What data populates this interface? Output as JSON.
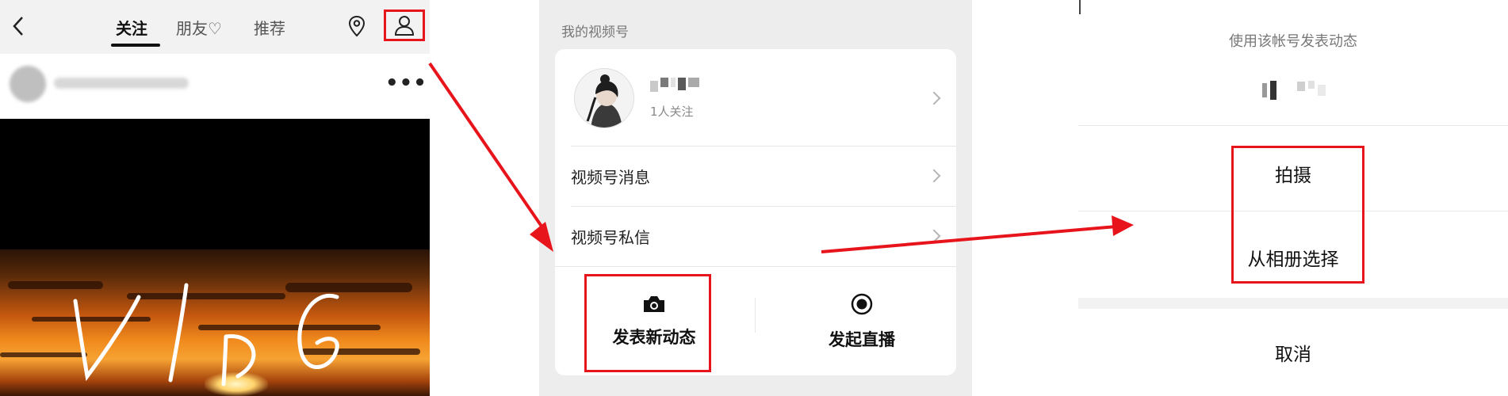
{
  "feed_screen": {
    "tabs": [
      {
        "label": "关注",
        "active": true
      },
      {
        "label": "朋友♡",
        "active": false
      },
      {
        "label": "推荐",
        "active": false
      }
    ],
    "icons": [
      "back-icon",
      "location-icon",
      "person-icon",
      "more-icon"
    ],
    "more_label": "•••",
    "video_overlay_text": "VLOG"
  },
  "channel_screen": {
    "section_title": "我的视频号",
    "profile": {
      "follow_count": "1人关注"
    },
    "menu_items": [
      {
        "label": "视频号消息"
      },
      {
        "label": "视频号私信"
      }
    ],
    "actions": [
      {
        "label": "发表新动态",
        "icon": "camera-icon"
      },
      {
        "label": "发起直播",
        "icon": "record-icon"
      }
    ]
  },
  "post_sheet": {
    "caption": "使用该帐号发表动态",
    "options": [
      {
        "label": "拍摄"
      },
      {
        "label": "从相册选择"
      }
    ],
    "cancel_label": "取消"
  },
  "colors": {
    "highlight": "#e8141c",
    "arrow": "#e8141c",
    "panel_gray": "#ededed"
  }
}
